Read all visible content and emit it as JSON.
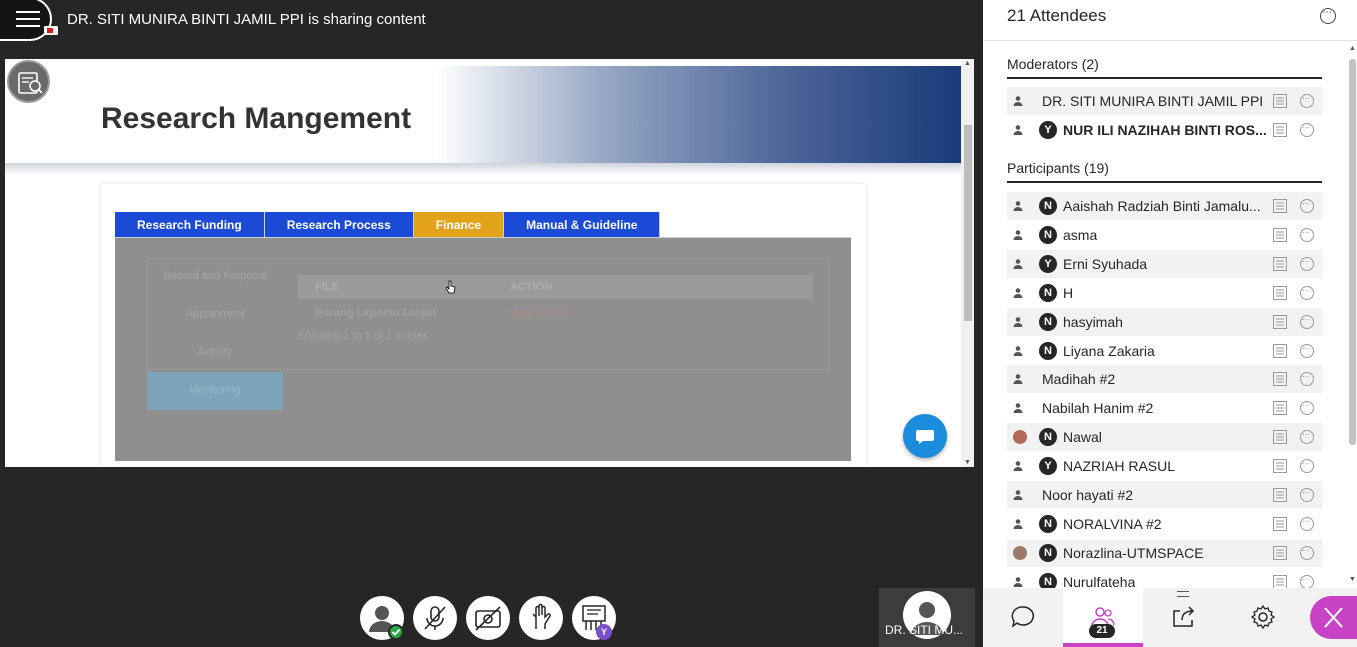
{
  "header": {
    "sharing_title": "DR. SITI MUNIRA BINTI JAMIL PPI is sharing content",
    "menu_icon": "hamburger-menu-icon",
    "recording_icon": "recording-camera-icon"
  },
  "shared_content": {
    "banner_title": "Research Mangement",
    "tabs": [
      "Research Funding",
      "Research Process",
      "Finance",
      "Manual & Guideline"
    ],
    "active_tab": "Finance",
    "side_menu": [
      "Record and Proposal",
      "Appoinment",
      "Activity",
      "Monitoring"
    ],
    "table_headers": [
      "FILE",
      "ACTION"
    ],
    "table_row": {
      "file": "Borang Laporan Lanjut",
      "action": "View in PDF"
    },
    "table_info": "Showing 1 to 1 of 1 entries"
  },
  "controls": {
    "my_status_badge": "Y",
    "video_tile_name": "DR. SITI MU..."
  },
  "panel": {
    "title": "21 Attendees",
    "moderators_label": "Moderators (2)",
    "participants_label": "Participants (19)",
    "moderators": [
      {
        "name": "DR. SITI MUNIRA BINTI JAMIL PPI",
        "initial": "",
        "bold": false
      },
      {
        "name": "NUR ILI NAZIHAH BINTI ROS...",
        "initial": "Y",
        "bold": true
      }
    ],
    "participants": [
      {
        "name": "Aaishah Radziah Binti Jamalu...",
        "initial": "N"
      },
      {
        "name": "asma",
        "initial": "N"
      },
      {
        "name": "Erni Syuhada",
        "initial": "Y"
      },
      {
        "name": "H",
        "initial": "N"
      },
      {
        "name": "hasyimah",
        "initial": "N"
      },
      {
        "name": "Liyana Zakaria",
        "initial": "N"
      },
      {
        "name": "Madihah #2",
        "initial": ""
      },
      {
        "name": "Nabilah Hanim #2",
        "initial": ""
      },
      {
        "name": "Nawal",
        "initial": "N"
      },
      {
        "name": "NAZRIAH RASUL",
        "initial": "Y"
      },
      {
        "name": "Noor hayati #2",
        "initial": ""
      },
      {
        "name": "NORALVINA #2",
        "initial": "N"
      },
      {
        "name": "Norazlina-UTMSPACE",
        "initial": "N"
      },
      {
        "name": "Nurulfateha",
        "initial": "N"
      }
    ],
    "attendee_count": "21"
  },
  "colors": {
    "accent": "#c742c4",
    "tab_blue": "#1a4ad6",
    "tab_active": "#e2a31a",
    "status_green": "#2aa84a",
    "badge_purple": "#7b4fc9"
  }
}
